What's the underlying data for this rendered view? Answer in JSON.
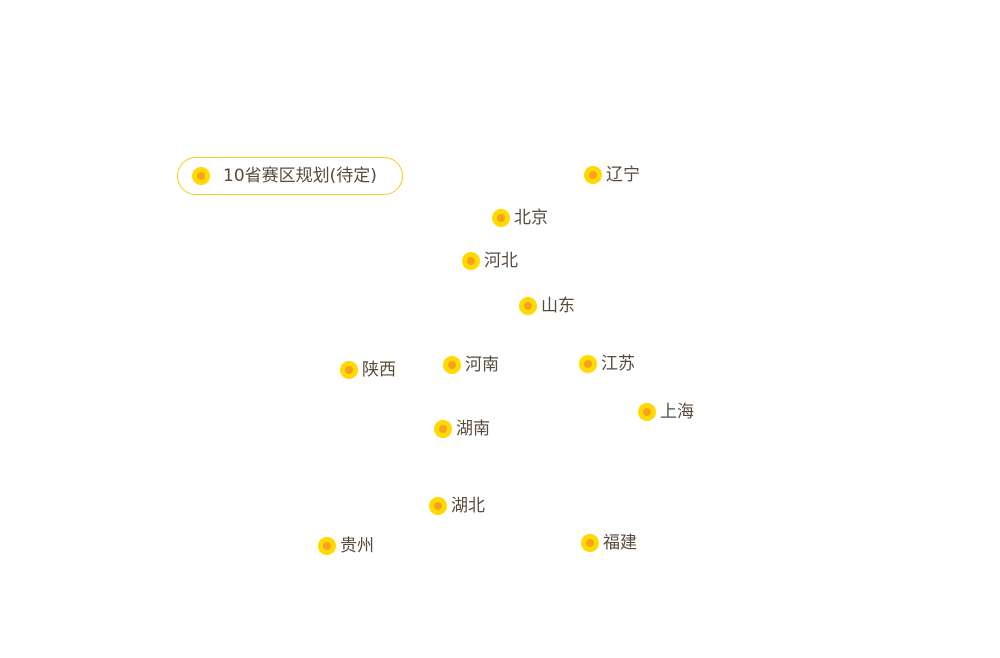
{
  "legend": {
    "label": "10省赛区规划(待定)",
    "dot_color": "#ffd900",
    "dot_center_color": "#f7a21c",
    "border_color": "#f2cf1a"
  },
  "markers": [
    {
      "name": "辽宁"
    },
    {
      "name": "北京"
    },
    {
      "name": "河北"
    },
    {
      "name": "山东"
    },
    {
      "name": "陕西"
    },
    {
      "name": "河南"
    },
    {
      "name": "江苏"
    },
    {
      "name": "上海"
    },
    {
      "name": "湖南"
    },
    {
      "name": "湖北"
    },
    {
      "name": "贵州"
    },
    {
      "name": "福建"
    }
  ]
}
